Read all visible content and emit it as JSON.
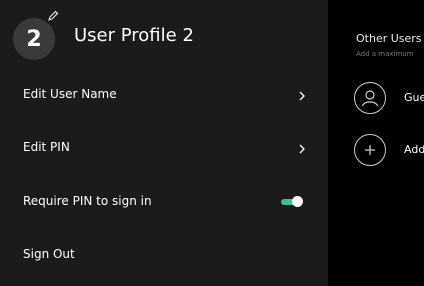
{
  "profile": {
    "avatar_number": "2",
    "title": "User Profile 2"
  },
  "menu": {
    "edit_user_name": "Edit User Name",
    "edit_pin": "Edit PIN",
    "require_pin": "Require PIN to sign in",
    "require_pin_enabled": true,
    "sign_out": "Sign Out"
  },
  "other_users": {
    "title": "Other Users",
    "subtitle": "Add a maximum",
    "guest_label": "Gue",
    "add_label": "Add"
  },
  "colors": {
    "toggle_on": "#3fbf8f",
    "left_panel_bg": "#1b1b1b"
  },
  "icons": {
    "avatar_edit": "pencil-icon",
    "row_chevron": "chevron-right-icon",
    "guest": "person-icon",
    "add": "plus-icon"
  }
}
